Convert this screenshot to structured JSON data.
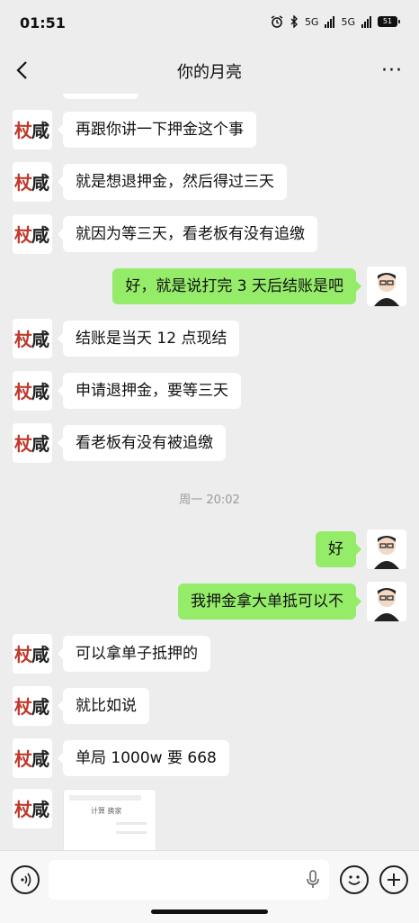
{
  "status_bar": {
    "time": "01:51",
    "battery": "51",
    "signal_label": "5G"
  },
  "nav": {
    "title": "你的月亮",
    "more": "···"
  },
  "chat": {
    "messages": [
      {
        "side": "left",
        "text": "再跟你讲一下押金这个事"
      },
      {
        "side": "left",
        "text": "就是想退押金，然后得过三天"
      },
      {
        "side": "left",
        "text": "就因为等三天，看老板有没有追缴"
      },
      {
        "side": "right",
        "text": "好，就是说打完 3 天后结账是吧"
      },
      {
        "side": "left",
        "text": "结账是当天 12 点现结"
      },
      {
        "side": "left",
        "text": "申请退押金，要等三天"
      },
      {
        "side": "left",
        "text": "看老板有没有被追缴"
      },
      {
        "side": "right",
        "text": "好"
      },
      {
        "side": "right",
        "text": "我押金拿大单抵可以不"
      },
      {
        "side": "left",
        "text": "可以拿单子抵押的"
      },
      {
        "side": "left",
        "text": "就比如说"
      },
      {
        "side": "left",
        "text": "单局 1000w 要 668"
      }
    ],
    "timestamp": "周一 20:02",
    "image_tab": "计算  换家"
  },
  "input": {
    "placeholder": ""
  },
  "colors": {
    "background": "#ededed",
    "bubble_self": "#95ec69",
    "bubble_other": "#ffffff"
  }
}
